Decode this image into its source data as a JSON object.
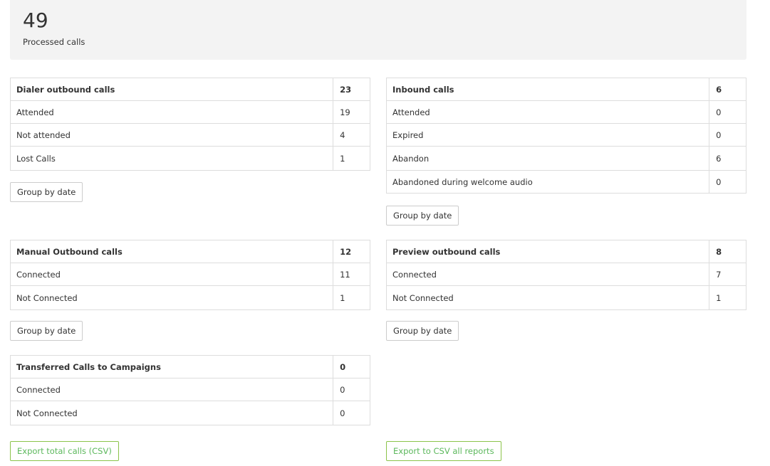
{
  "summary": {
    "total": "49",
    "label": "Processed calls"
  },
  "dialer": {
    "title": "Dialer outbound calls",
    "title_value": "23",
    "rows": [
      {
        "label": "Attended",
        "value": "19"
      },
      {
        "label": "Not attended",
        "value": "4"
      },
      {
        "label": "Lost Calls",
        "value": "1"
      }
    ],
    "button": "Group by date"
  },
  "inbound": {
    "title": "Inbound calls",
    "title_value": "6",
    "rows": [
      {
        "label": "Attended",
        "value": "0"
      },
      {
        "label": "Expired",
        "value": "0"
      },
      {
        "label": "Abandon",
        "value": "6"
      },
      {
        "label": "Abandoned during welcome audio",
        "value": "0"
      }
    ],
    "button": "Group by date"
  },
  "manual": {
    "title": "Manual Outbound calls",
    "title_value": "12",
    "rows": [
      {
        "label": "Connected",
        "value": "11"
      },
      {
        "label": "Not Connected",
        "value": "1"
      }
    ],
    "button": "Group by date"
  },
  "preview": {
    "title": "Preview outbound calls",
    "title_value": "8",
    "rows": [
      {
        "label": "Connected",
        "value": "7"
      },
      {
        "label": "Not Connected",
        "value": "1"
      }
    ],
    "button": "Group by date"
  },
  "transferred": {
    "title": "Transferred Calls to Campaigns",
    "title_value": "0",
    "rows": [
      {
        "label": "Connected",
        "value": "0"
      },
      {
        "label": "Not Connected",
        "value": "0"
      }
    ]
  },
  "export": {
    "total_label": "Export total calls (CSV)",
    "all_label": "Export to CSV all reports"
  }
}
